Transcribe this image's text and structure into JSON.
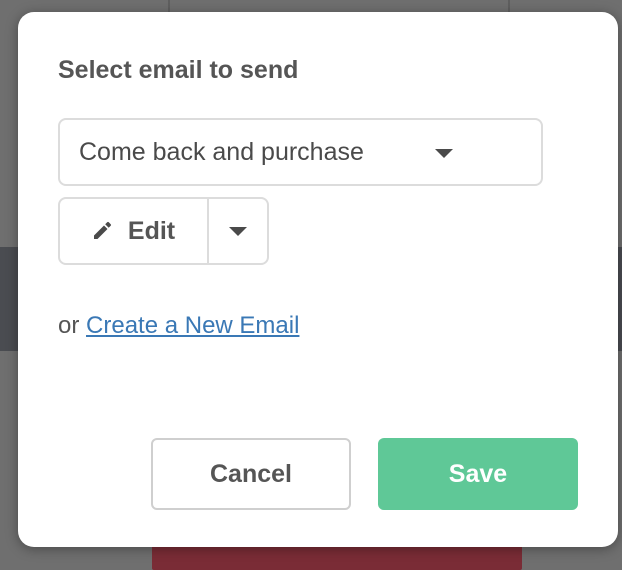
{
  "modal": {
    "title": "Select email to send",
    "email_select": {
      "value": "Come back and purchase"
    },
    "edit_button": {
      "label": "Edit"
    },
    "create_prefix": "or",
    "create_link": "Create a New Email",
    "cancel_label": "Cancel",
    "save_label": "Save"
  },
  "icons": {
    "caret": "chevron-down-icon",
    "edit": "pencil-icon"
  },
  "colors": {
    "save_bg": "#5fc897",
    "link": "#3a78b5",
    "overlay": "#6f6f6f"
  }
}
